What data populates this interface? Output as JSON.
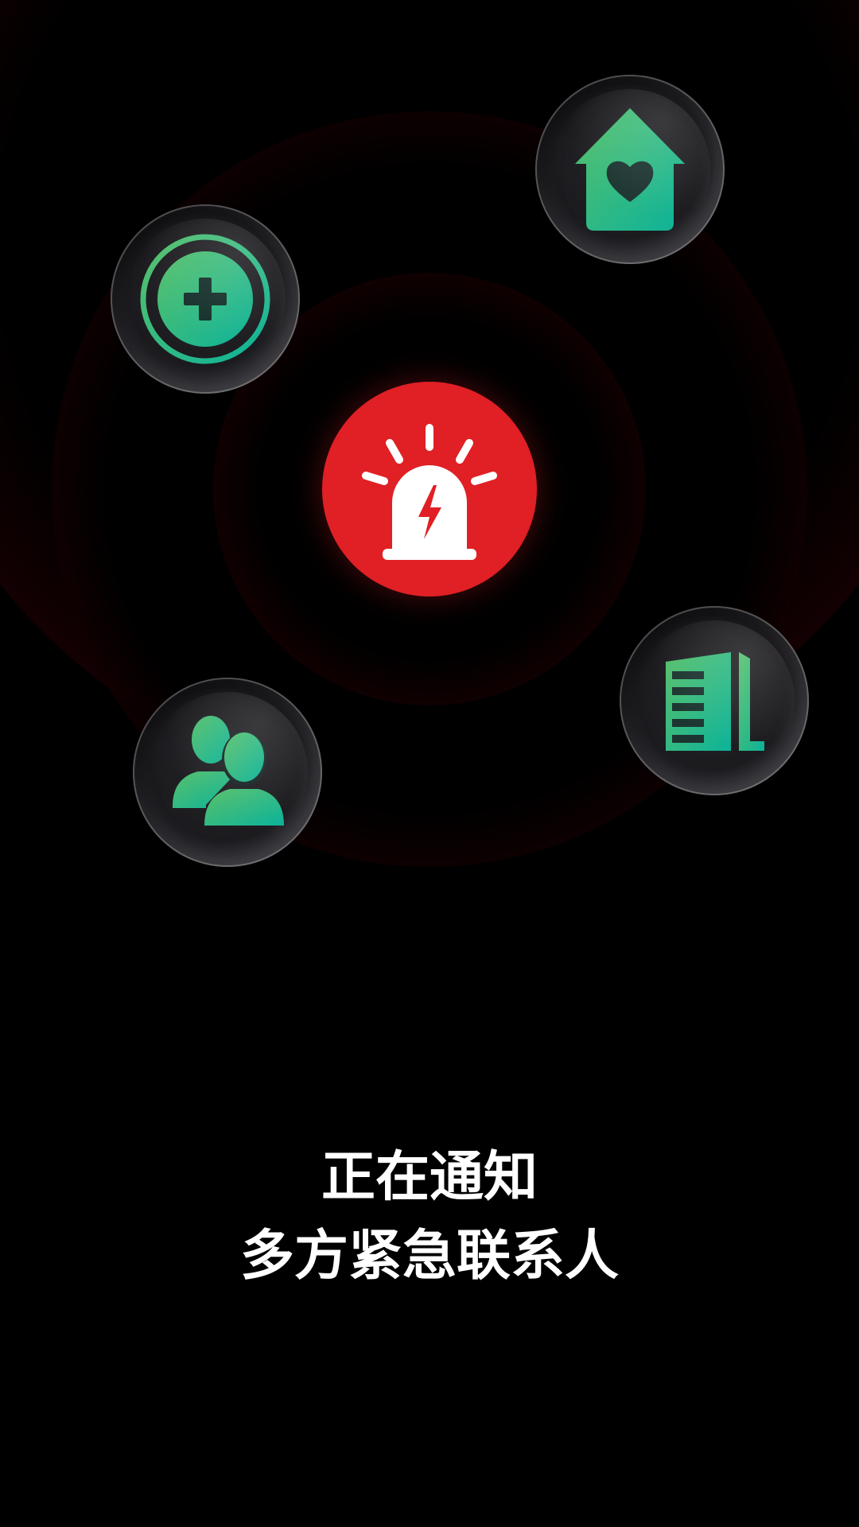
{
  "screen": {
    "background_color": "#000000",
    "ripple_color": "#4b0008"
  },
  "alarm": {
    "icon": "siren-icon",
    "color": "#e02025"
  },
  "contacts_orbit": [
    {
      "icon": "medical-cross-icon",
      "label": ""
    },
    {
      "icon": "home-heart-icon",
      "label": ""
    },
    {
      "icon": "building-icon",
      "label": ""
    },
    {
      "icon": "contacts-icon",
      "label": ""
    }
  ],
  "icon_gradient": {
    "start": "#59c06a",
    "end": "#0cb39a"
  },
  "status": {
    "line1": "正在通知",
    "line2": "多方紧急联系人"
  }
}
